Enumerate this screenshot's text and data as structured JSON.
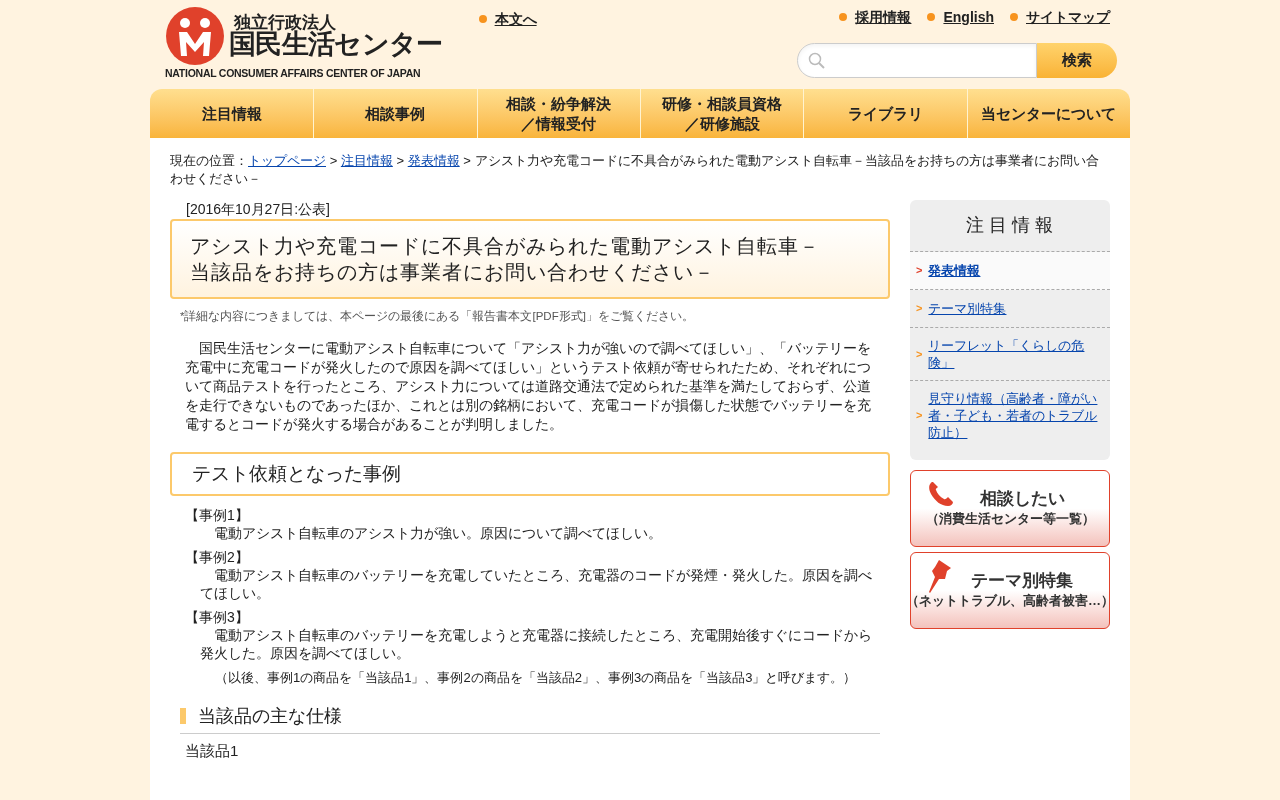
{
  "header": {
    "org_small": "独立行政法人",
    "org_name": "国民生活センター",
    "org_english": "NATIONAL CONSUMER AFFAIRS CENTER OF JAPAN",
    "skip_link": "本文へ",
    "utility_links": [
      "採用情報",
      "English",
      "サイトマップ"
    ],
    "search": {
      "button": "検索"
    }
  },
  "nav": [
    {
      "lines": [
        "注目情報"
      ],
      "selected": false
    },
    {
      "lines": [
        "相談事例"
      ],
      "selected": false
    },
    {
      "lines": [
        "相談・紛争解決",
        "／情報受付"
      ],
      "selected": false
    },
    {
      "lines": [
        "研修・相談員資格",
        "／研修施設"
      ],
      "selected": false
    },
    {
      "lines": [
        "ライブラリ"
      ],
      "selected": false
    },
    {
      "lines": [
        "当センターについて"
      ],
      "selected": false
    }
  ],
  "breadcrumb": {
    "prefix": "現在の位置：",
    "separator": ">",
    "links": [
      "トップページ",
      "注目情報",
      "発表情報"
    ],
    "current": "アシスト力や充電コードに不具合がみられた電動アシスト自転車－当該品をお持ちの方は事業者にお問い合わせください－"
  },
  "article": {
    "date": "[2016年10月27日:公表]",
    "title_lines": [
      "アシスト力や充電コードに不具合がみられた電動アシスト自転車－",
      "当該品をお持ちの方は事業者にお問い合わせください－"
    ],
    "note": "*詳細な内容につきましては、本ページの最後にある「報告書本文[PDF形式]」をご覧ください。",
    "lead": "国民生活センターに電動アシスト自転車について「アシスト力が強いので調べてほしい」、「バッテリーを充電中に充電コードが発火したので原因を調べてほしい」というテスト依頼が寄せられたため、それぞれについて商品テストを行ったところ、アシスト力については道路交通法で定められた基準を満たしておらず、公道を走行できないものであったほか、これとは別の銘柄において、充電コードが損傷した状態でバッテリーを充電するとコードが発火する場合があることが判明しました。",
    "section_title": "テスト依頼となった事例",
    "cases": [
      {
        "label": "【事例1】",
        "text": "電動アシスト自転車のアシスト力が強い。原因について調べてほしい。"
      },
      {
        "label": "【事例2】",
        "text": "電動アシスト自転車のバッテリーを充電していたところ、充電器のコードが発煙・発火した。原因を調べてほしい。"
      },
      {
        "label": "【事例3】",
        "text": "電動アシスト自転車のバッテリーを充電しようと充電器に接続したところ、充電開始後すぐにコードから発火した。原因を調べてほしい。"
      }
    ],
    "cases_note": "（以後、事例1の商品を「当該品1」、事例2の商品を「当該品2」、事例3の商品を「当該品3」と呼びます。）",
    "subsection_title": "当該品の主な仕様",
    "item_label": "当該品1"
  },
  "sidebar": {
    "title": "注 目 情 報",
    "marker": ">",
    "items": [
      {
        "label": "発表情報",
        "selected": true
      },
      {
        "label": "テーマ別特集",
        "selected": false
      },
      {
        "label": "リーフレット「くらしの危険」",
        "selected": false
      },
      {
        "label": "見守り情報（高齢者・障がい者・子ども・若者のトラブル防止）",
        "selected": false
      }
    ],
    "banners": [
      {
        "kind": "phone",
        "title": "相談したい",
        "subtitle": "（消費生活センター等一覧）"
      },
      {
        "kind": "pin",
        "title": "テーマ別特集",
        "subtitle": "（ネットトラブル、高齢者被害…）"
      }
    ]
  }
}
